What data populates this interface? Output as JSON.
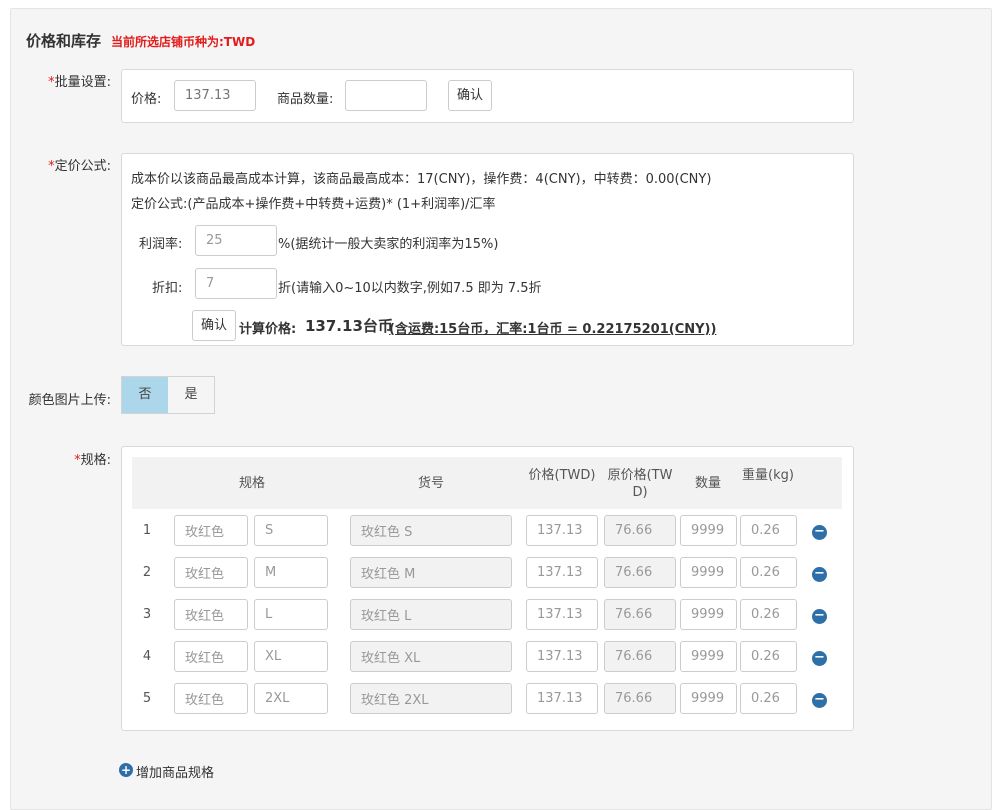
{
  "header": {
    "title": "价格和库存",
    "currency_note": "当前所选店铺币种为:TWD"
  },
  "batch": {
    "label": "批量设置:",
    "price_label": "价格:",
    "price_value": "137.13",
    "qty_label": "商品数量:",
    "qty_value": "",
    "confirm": "确认"
  },
  "formula": {
    "label": "定价公式:",
    "line1": "成本价以该商品最高成本计算，该商品最高成本：17(CNY)，操作费：4(CNY)，中转费：0.00(CNY)",
    "line2": "定价公式:(产品成本+操作费+中转费+运费)* (1+利润率)/汇率",
    "profit_label": "利润率:",
    "profit_value": "25",
    "profit_hint": "%(据统计一般大卖家的利润率为15%)",
    "discount_label": "折扣:",
    "discount_value": "7",
    "discount_hint": "折(请输入0~10以内数字,例如7.5 即为 7.5折",
    "confirm": "确认",
    "calc_label": "计算价格:",
    "calc_value": "137.13台币",
    "calc_detail": "(含运费:15台币，汇率:1台币 = 0.22175201(CNY))"
  },
  "color_upload": {
    "label": "颜色图片上传:",
    "no": "否",
    "yes": "是",
    "selected": "否"
  },
  "spec": {
    "label": "规格:",
    "columns": {
      "spec": "规格",
      "sku": "货号",
      "price": "价格(TWD)",
      "orig_price": "原价格(TWD)",
      "qty": "数量",
      "weight": "重量(kg)"
    },
    "rows": [
      {
        "num": "1",
        "color": "玫红色",
        "size": "S",
        "sku": "玫红色 S",
        "price": "137.13",
        "orig": "76.66",
        "qty": "9999",
        "weight": "0.26"
      },
      {
        "num": "2",
        "color": "玫红色",
        "size": "M",
        "sku": "玫红色 M",
        "price": "137.13",
        "orig": "76.66",
        "qty": "9999",
        "weight": "0.26"
      },
      {
        "num": "3",
        "color": "玫红色",
        "size": "L",
        "sku": "玫红色 L",
        "price": "137.13",
        "orig": "76.66",
        "qty": "9999",
        "weight": "0.26"
      },
      {
        "num": "4",
        "color": "玫红色",
        "size": "XL",
        "sku": "玫红色 XL",
        "price": "137.13",
        "orig": "76.66",
        "qty": "9999",
        "weight": "0.26"
      },
      {
        "num": "5",
        "color": "玫红色",
        "size": "2XL",
        "sku": "玫红色 2XL",
        "price": "137.13",
        "orig": "76.66",
        "qty": "9999",
        "weight": "0.26"
      }
    ],
    "add_label": "增加商品规格"
  },
  "colors": {
    "required": "#e21b1b",
    "toggle_on": "#acd6e9",
    "icon_blue": "#2f6fa8"
  }
}
